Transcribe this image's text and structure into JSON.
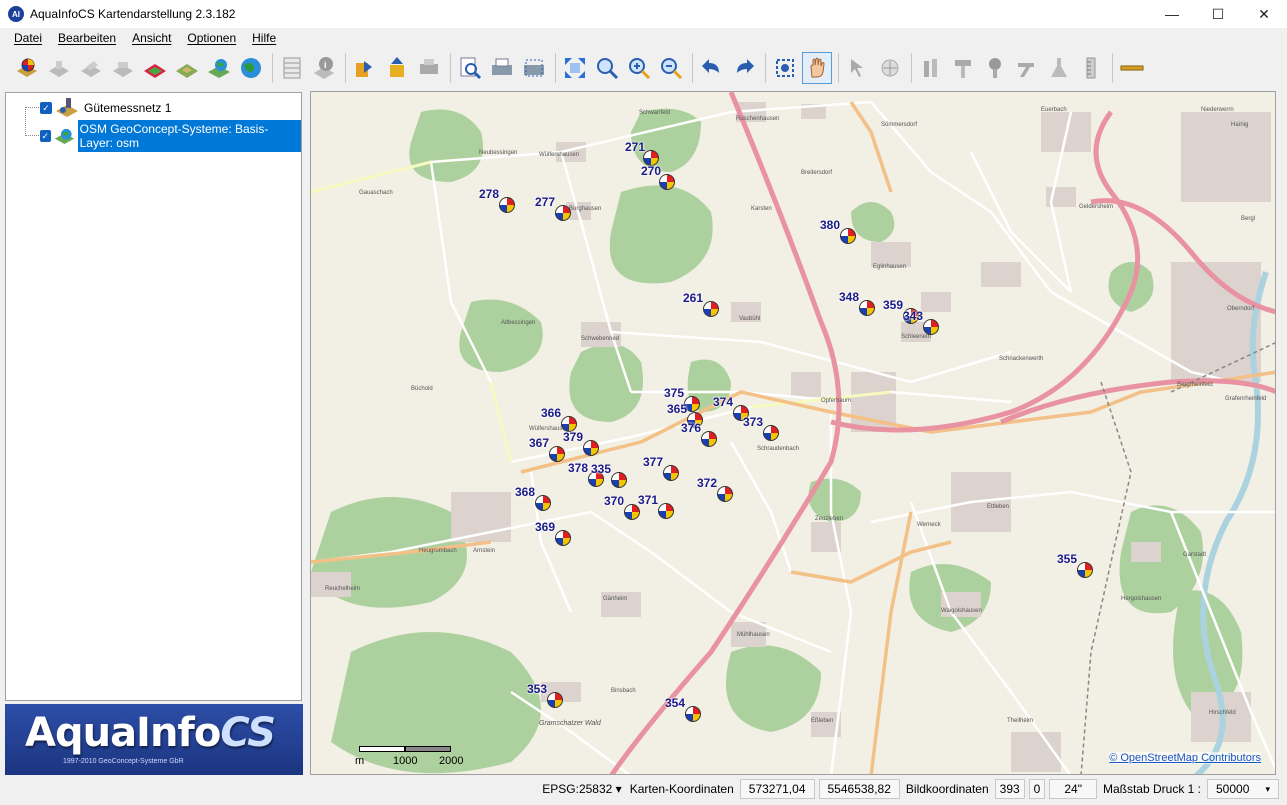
{
  "window": {
    "title": "AquaInfoCS Kartendarstellung 2.3.182",
    "minimize": "—",
    "maximize": "☐",
    "close": "✕"
  },
  "menu": [
    "Datei",
    "Bearbeiten",
    "Ansicht",
    "Optionen",
    "Hilfe"
  ],
  "tree": {
    "items": [
      {
        "label": "Gütemessnetz 1",
        "checked": true
      },
      {
        "label": "OSM GeoConcept-Systeme: Basis-Layer: osm",
        "checked": true
      }
    ]
  },
  "logo": {
    "brand": "AquaInfo",
    "brand_cs": "CS",
    "sub": "1997-2010 GeoConcept-Systeme GbR"
  },
  "map": {
    "markers": [
      "271",
      "270",
      "278",
      "277",
      "380",
      "261",
      "348",
      "359",
      "343",
      "375",
      "374",
      "365",
      "366",
      "379",
      "367",
      "376",
      "373",
      "378",
      "335",
      "377",
      "372",
      "368",
      "371",
      "370",
      "369",
      "355",
      "353",
      "354"
    ],
    "places": [
      "Schwanfeld",
      "Ruschenhausen",
      "Sömmersdorf",
      "Euerbach",
      "Niederwerrn",
      "Haïnig",
      "Neubessingen",
      "Wülfershausen",
      "Breitersdorf",
      "Gauaschach",
      "Burghausen",
      "Karsten",
      "Geldersheim",
      "Bergl",
      "Altbessingen",
      "Vasbühl",
      "Eglinhausen",
      "Oberndorf",
      "Schwebenried",
      "Schraudenbach",
      "Schleerieth",
      "Schnackenwerth",
      "Bergrheinfeld",
      "Grafenrheinfeld",
      "Büchold",
      "Opferbaum",
      "Ettleben",
      "Wülfershausen",
      "Werneck",
      "Zeuzleben",
      "Garstadt",
      "Heugrumbach",
      "Arnstein",
      "Gänheim",
      "Hergolshausen",
      "Reuchelheim",
      "Waigolshausen",
      "Mühlhausen",
      "Binsbach",
      "Eßleben",
      "Theilheim",
      "Hirschfeld",
      "Gramschatzer Wald"
    ],
    "scale_labels": [
      "m",
      "1000",
      "2000"
    ],
    "attribution": "© OpenStreetMap Contributors"
  },
  "status": {
    "epsg": "EPSG:25832",
    "karten_label": "Karten-Koordinaten",
    "x": "573271,04",
    "y": "5546538,82",
    "bild_label": "Bildkoordinaten",
    "bx": "393",
    "by": "0",
    "inches": "24\"",
    "massstab_label": "Maßstab Druck 1 :",
    "massstab": "50000"
  }
}
